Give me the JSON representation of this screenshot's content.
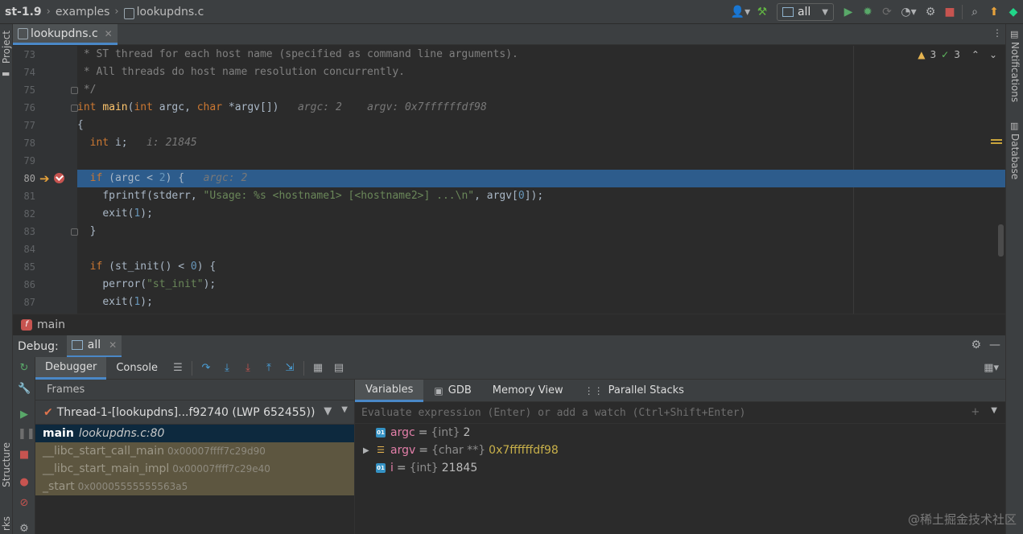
{
  "topbar": {
    "crumbs": [
      "st-1.9",
      "examples",
      "lookupdns.c"
    ],
    "run_config": "all"
  },
  "side": {
    "project": "Project",
    "structure": "Structure",
    "bookmarks": "rks",
    "notifications": "Notifications",
    "database": "Database"
  },
  "editor": {
    "tab": "lookupdns.c",
    "inspection": {
      "warnings": "3",
      "weak_warnings": "3"
    },
    "line_numbers": [
      "73",
      "74",
      "75",
      "76",
      "77",
      "78",
      "79",
      "80",
      "81",
      "82",
      "83",
      "84",
      "85",
      "86",
      "87"
    ],
    "lines": {
      "l73": " * ST thread for each host name (specified as command line arguments).",
      "l74": " * All threads do host name resolution concurrently.",
      "l75": " */",
      "l76_kw": "int",
      "l76_fn": "main",
      "l76_p1": "(",
      "l76_kw2": "int",
      "l76_p2": " argc, ",
      "l76_kw3": "char",
      "l76_p3": " *argv[])",
      "l76_inlay1": "argc: 2",
      "l76_inlay2": "argv: 0x7ffffffdf98",
      "l77": "{",
      "l78_kw": "int",
      "l78_rest": " i;",
      "l78_inlay": "i: 21845",
      "l79": "",
      "l80_kw": "if",
      "l80_a": " (argc < ",
      "l80_num": "2",
      "l80_b": ") {",
      "l80_inlay": "argc: 2",
      "l81_a": "fprintf(stderr, ",
      "l81_str": "\"Usage: %s <hostname1> [<hostname2>] ...\\n\"",
      "l81_b": ", argv[",
      "l81_num": "0",
      "l81_c": "]);",
      "l82_a": "exit(",
      "l82_num": "1",
      "l82_b": ");",
      "l83": "}",
      "l84": "",
      "l85_kw": "if",
      "l85_a": " (st_init() < ",
      "l85_num": "0",
      "l85_b": ") {",
      "l86_a": "perror(",
      "l86_str": "\"st_init\"",
      "l86_b": ");",
      "l87_a": "exit(",
      "l87_num": "1",
      "l87_b": ");"
    },
    "function_crumb": "main"
  },
  "debug": {
    "title": "Debug:",
    "session_tab": "all",
    "subtabs": [
      "Debugger",
      "Console"
    ],
    "frames": {
      "header": "Frames",
      "thread": "Thread-1-[lookupdns]...f92740 (LWP 652455))",
      "items": [
        {
          "name": "main",
          "loc": "lookupdns.c:80"
        },
        {
          "name": "__libc_start_call_main",
          "addr": "0x00007ffff7c29d90"
        },
        {
          "name": "__libc_start_main_impl",
          "addr": "0x00007ffff7c29e40"
        },
        {
          "name": "_start",
          "addr": "0x00005555555563a5"
        }
      ]
    },
    "variables": {
      "tabs": [
        "Variables",
        "GDB",
        "Memory View",
        "Parallel Stacks"
      ],
      "eval_placeholder": "Evaluate expression (Enter) or add a watch (Ctrl+Shift+Enter)",
      "items": [
        {
          "name": "argc",
          "type": "{int}",
          "value": "2"
        },
        {
          "name": "argv",
          "type": "{char **}",
          "value": "0x7ffffffdf98"
        },
        {
          "name": "i",
          "type": "{int}",
          "value": "21845"
        }
      ]
    }
  },
  "watermark": "@稀土掘金技术社区",
  "colors": {
    "accent": "#4a88c7",
    "current_line": "#2d5c8c",
    "keyword": "#cc7832",
    "string": "#6a8759",
    "number": "#6897bb"
  }
}
